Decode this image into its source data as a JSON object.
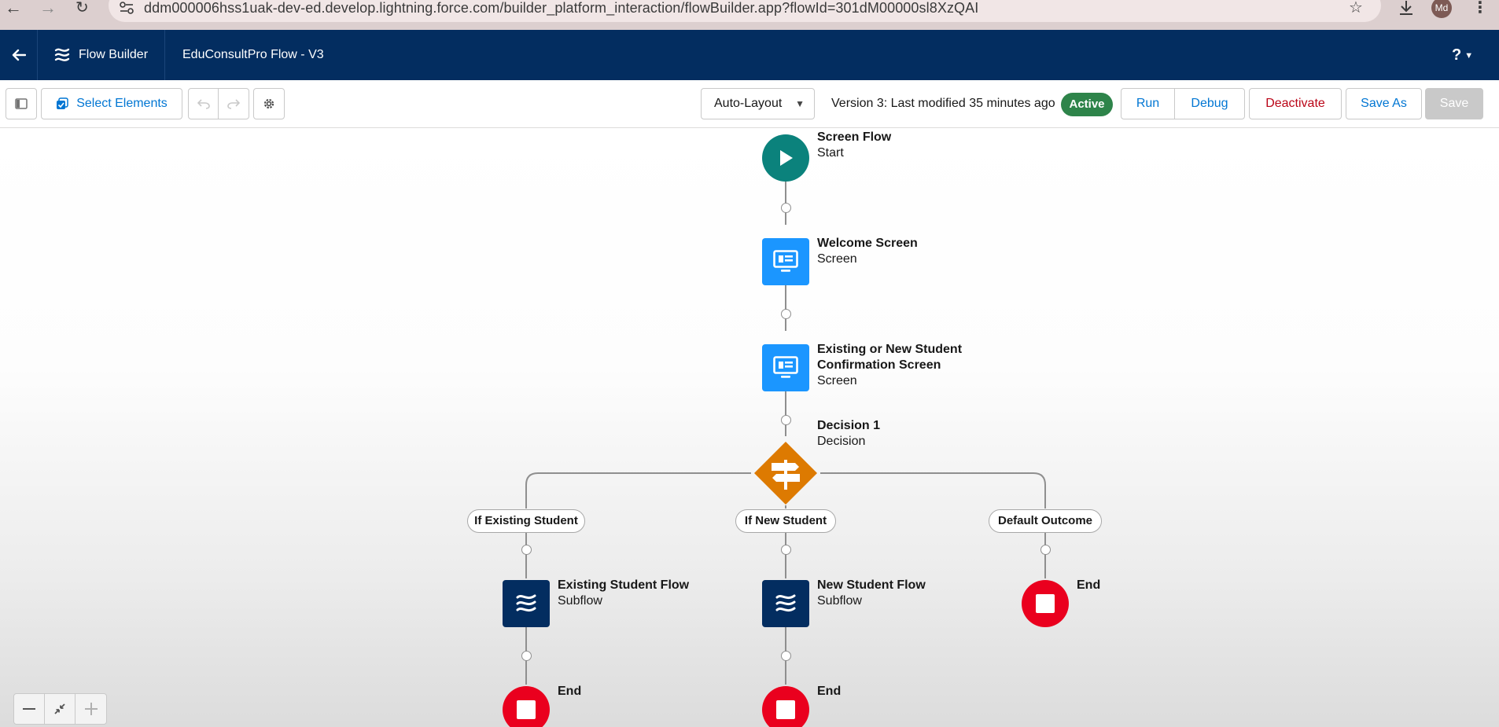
{
  "browser": {
    "url": "ddm000006hss1uak-dev-ed.develop.lightning.force.com/builder_platform_interaction/flowBuilder.app?flowId=301dM00000sl8XzQAI",
    "avatar_initials": "Md"
  },
  "header": {
    "app_name": "Flow Builder",
    "flow_name": "EduConsultPro Flow - V3",
    "help_label": "?"
  },
  "toolbar": {
    "select_elements_label": "Select Elements",
    "layout_select": "Auto-Layout",
    "version_text": "Version 3: Last modified 35 minutes ago",
    "status_badge": "Active",
    "run_label": "Run",
    "debug_label": "Debug",
    "deactivate_label": "Deactivate",
    "save_as_label": "Save As",
    "save_label": "Save"
  },
  "flow": {
    "start": {
      "title": "Screen Flow",
      "subtitle": "Start"
    },
    "welcome": {
      "title": "Welcome Screen",
      "subtitle": "Screen"
    },
    "confirmation": {
      "title_line1": "Existing or New Student",
      "title_line2": "Confirmation Screen",
      "subtitle": "Screen"
    },
    "decision": {
      "title": "Decision 1",
      "subtitle": "Decision"
    },
    "outcomes": {
      "existing": "If Existing Student",
      "new": "If New Student",
      "default": "Default Outcome"
    },
    "existing_subflow": {
      "title": "Existing Student Flow",
      "subtitle": "Subflow"
    },
    "new_subflow": {
      "title": "New Student Flow",
      "subtitle": "Subflow"
    },
    "end_label": "End"
  },
  "colors": {
    "header_bg": "#032d60",
    "start_node": "#0b827c",
    "screen_node": "#1b96ff",
    "decision_node": "#dd7a01",
    "subflow_node": "#032d60",
    "end_node": "#ea001e",
    "active_badge": "#2e844a"
  }
}
